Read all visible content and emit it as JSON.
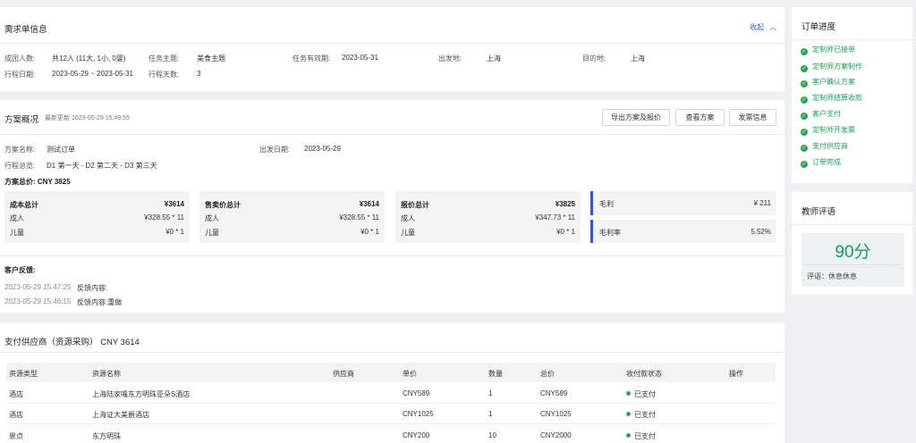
{
  "requirement": {
    "title": "需求单信息",
    "collapse": "收起",
    "fields": {
      "group_label": "成团人数:",
      "group_value": "共12人 (11大, 1小, 0婴)",
      "theme_label": "任务主题:",
      "theme_value": "美食主题",
      "validity_label": "任务有效期:",
      "validity_value": "2023-05-31",
      "depart_label": "出发地:",
      "depart_value": "上海",
      "dest_label": "目的地:",
      "dest_value": "上海",
      "dates_label": "行程日期:",
      "dates_value": "2023-05-29 ~ 2023-05-31",
      "days_label": "行程天数:",
      "days_value": "3"
    }
  },
  "plan": {
    "title": "方案概况",
    "updated": "最新更新 2023-05-29 15:49:55",
    "buttons": [
      "导出方案及报价",
      "查看方案",
      "发票信息"
    ],
    "name_label": "方案名称:",
    "name_value": "测试订单",
    "depart_date_label": "出发日期:",
    "depart_date_value": "2023-05-29",
    "overview_label": "行程总览:",
    "overview_value": "D1 第一天 - D2 第二天 - D3 第三天",
    "total": "方案总价: CNY 3825",
    "boxes": [
      {
        "title": "成本总计",
        "total": "¥3614",
        "adult_label": "成人",
        "adult": "¥328.55 * 11",
        "child_label": "儿童",
        "child": "¥0 * 1"
      },
      {
        "title": "售卖价总计",
        "total": "¥3614",
        "adult_label": "成人",
        "adult": "¥328.55 * 11",
        "child_label": "儿童",
        "child": "¥0 * 1"
      },
      {
        "title": "报价总计",
        "total": "¥3825",
        "adult_label": "成人",
        "adult": "¥347.73 * 11",
        "child_label": "儿童",
        "child": "¥0 * 1"
      }
    ],
    "profit_label": "毛利",
    "profit_value": "¥ 211",
    "rate_label": "毛利率",
    "rate_value": "5.52%",
    "feedback_title": "客户反馈:",
    "feedback": [
      {
        "time": "2023-05-29 15:47:25",
        "text": "反馈内容:"
      },
      {
        "time": "2023-05-29 15:46:15",
        "text": "反馈内容:重做"
      }
    ]
  },
  "supplier": {
    "title": "支付供应商（资源采购） CNY 3614",
    "headers": [
      "资源类型",
      "资源名称",
      "供应商",
      "单价",
      "数量",
      "总价",
      "收付款状态",
      "操作"
    ],
    "rows": [
      {
        "type": "酒店",
        "name": "上海陆家嘴东方明珠亚朵S酒店",
        "supplier": "",
        "price": "CNY589",
        "qty": "1",
        "total": "CNY589",
        "status": "已支付"
      },
      {
        "type": "酒店",
        "name": "上海证大美爵酒店",
        "supplier": "",
        "price": "CNY1025",
        "qty": "1",
        "total": "CNY1025",
        "status": "已支付"
      },
      {
        "type": "景点",
        "name": "东方明珠",
        "supplier": "",
        "price": "CNY200",
        "qty": "10",
        "total": "CNY2000",
        "status": "已支付"
      }
    ]
  },
  "progress": {
    "title": "订单进度",
    "steps": [
      "定制师已接单",
      "定制师方案制作",
      "客户确认方案",
      "定制师结算收款",
      "客户支付",
      "定制师开发票",
      "支付供应商",
      "订单完成"
    ]
  },
  "review": {
    "title": "教师评语",
    "score": "90分",
    "comment": "评语：休息休息"
  },
  "colors": {
    "accent": "#2f54eb",
    "success": "#2ea84d",
    "score": "#1aa053"
  }
}
